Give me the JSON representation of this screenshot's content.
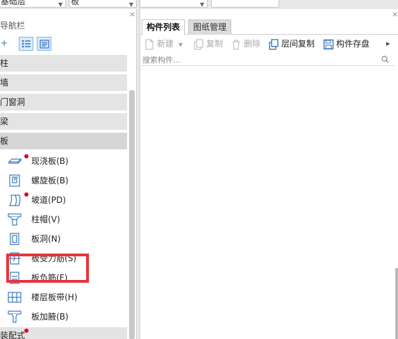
{
  "top_dropdowns": [
    {
      "value": "基础层"
    },
    {
      "value": "板"
    },
    {
      "value": ""
    },
    {
      "value": ""
    }
  ],
  "nav": {
    "title": "导航栏",
    "close": "×",
    "toolbar": {
      "add": "+"
    },
    "categories": [
      {
        "label": "柱"
      },
      {
        "label": "墙"
      },
      {
        "label": "门窗洞"
      },
      {
        "label": "梁"
      },
      {
        "label": "板"
      }
    ],
    "items": [
      {
        "label": "现浇板(B)",
        "icon": "cast-slab-icon"
      },
      {
        "label": "螺旋板(B)",
        "icon": "spiral-slab-icon"
      },
      {
        "label": "坡道(PD)",
        "icon": "ramp-icon"
      },
      {
        "label": "柱帽(V)",
        "icon": "column-cap-icon"
      },
      {
        "label": "板洞(N)",
        "icon": "slab-hole-icon"
      },
      {
        "label": "板受力筋(S)",
        "icon": "slab-main-rebar-icon"
      },
      {
        "label": "板负筋(F)",
        "icon": "slab-negative-rebar-icon"
      },
      {
        "label": "楼层板带(H)",
        "icon": "floor-slab-strip-icon"
      },
      {
        "label": "板加腋(B)",
        "icon": "slab-haunch-icon"
      }
    ],
    "bottom_category": "装配式"
  },
  "component_panel": {
    "close": "×",
    "tabs": [
      {
        "label": "构件列表"
      },
      {
        "label": "图纸管理"
      }
    ],
    "toolbar": {
      "new_label": "新建",
      "copy_label": "复制",
      "delete_label": "删除",
      "floor_copy_label": "层间复制",
      "save_label": "构件存盘",
      "more": "▸"
    },
    "search": {
      "placeholder": "搜索构件..."
    }
  },
  "colors": {
    "highlight": "#e8333a",
    "marker_dot": "#e0001a",
    "accent": "#2a6db8"
  }
}
